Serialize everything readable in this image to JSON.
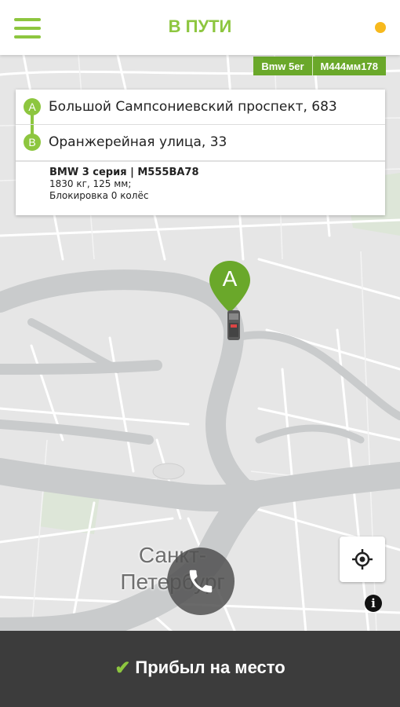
{
  "header": {
    "title": "В ПУТИ",
    "menu_icon": "hamburger-menu-icon",
    "status_color": "#f7b91d"
  },
  "vehicle_badge": {
    "model": "Bmw 5er",
    "plate": "М444мм178"
  },
  "route": {
    "point_a": {
      "label": "A",
      "address": "Большой Сампсониевский проспект, 683"
    },
    "point_b": {
      "label": "B",
      "address": "Оранжерейная улица, 33"
    },
    "details": {
      "car": "BMW 3 серия | М555ВА78",
      "specs": "1830 кг, 125 мм;",
      "blocking": "Блокировка 0 колёс"
    }
  },
  "map": {
    "marker_label": "A",
    "city_label_1": "Санкт-",
    "city_label_2": "Петербург"
  },
  "controls": {
    "call_icon": "phone-icon",
    "locate_icon": "crosshair-icon",
    "info_label": "i"
  },
  "action": {
    "arrived_label": "Прибыл на место",
    "check_icon": "✔"
  },
  "colors": {
    "accent": "#8dc63f",
    "badge": "#6aa82a",
    "action_bar": "#3c3c3c"
  }
}
